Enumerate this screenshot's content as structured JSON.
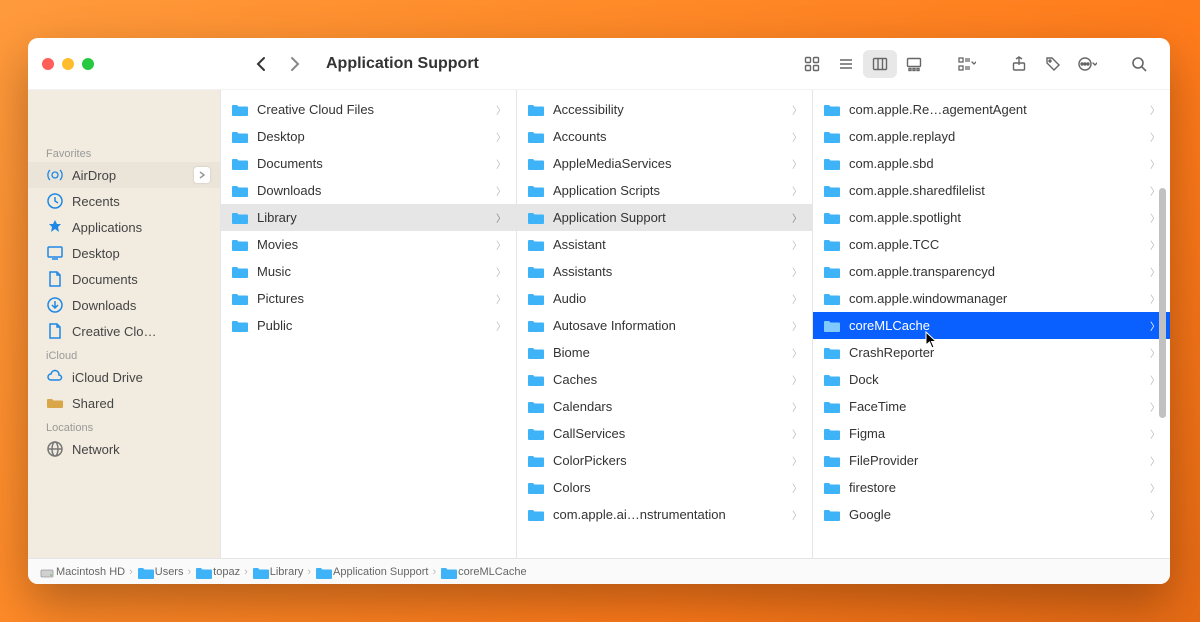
{
  "window": {
    "title": "Application Support"
  },
  "traffic": {
    "close": "close",
    "min": "minimize",
    "max": "maximize"
  },
  "sidebar": {
    "sections": [
      {
        "label": "Favorites",
        "items": [
          {
            "icon": "airdrop",
            "label": "AirDrop",
            "showChevron": true
          },
          {
            "icon": "clock",
            "label": "Recents"
          },
          {
            "icon": "app",
            "label": "Applications"
          },
          {
            "icon": "desktop",
            "label": "Desktop"
          },
          {
            "icon": "doc",
            "label": "Documents"
          },
          {
            "icon": "download",
            "label": "Downloads"
          },
          {
            "icon": "doc",
            "label": "Creative Clo…"
          }
        ]
      },
      {
        "label": "iCloud",
        "items": [
          {
            "icon": "cloud",
            "label": "iCloud Drive"
          },
          {
            "icon": "shared",
            "label": "Shared"
          }
        ]
      },
      {
        "label": "Locations",
        "items": [
          {
            "icon": "network",
            "label": "Network"
          }
        ]
      }
    ]
  },
  "column1": {
    "items": [
      {
        "label": "Creative Cloud Files"
      },
      {
        "label": "Desktop"
      },
      {
        "label": "Documents"
      },
      {
        "label": "Downloads"
      },
      {
        "label": "Library",
        "path": true
      },
      {
        "label": "Movies"
      },
      {
        "label": "Music"
      },
      {
        "label": "Pictures"
      },
      {
        "label": "Public"
      }
    ]
  },
  "column2": {
    "items": [
      {
        "label": "Accessibility"
      },
      {
        "label": "Accounts"
      },
      {
        "label": "AppleMediaServices"
      },
      {
        "label": "Application Scripts"
      },
      {
        "label": "Application Support",
        "path": true
      },
      {
        "label": "Assistant"
      },
      {
        "label": "Assistants"
      },
      {
        "label": "Audio"
      },
      {
        "label": "Autosave Information"
      },
      {
        "label": "Biome"
      },
      {
        "label": "Caches"
      },
      {
        "label": "Calendars"
      },
      {
        "label": "CallServices"
      },
      {
        "label": "ColorPickers"
      },
      {
        "label": "Colors"
      },
      {
        "label": "com.apple.ai…nstrumentation"
      }
    ]
  },
  "column3": {
    "items": [
      {
        "label": "com.apple.Re…agementAgent"
      },
      {
        "label": "com.apple.replayd"
      },
      {
        "label": "com.apple.sbd"
      },
      {
        "label": "com.apple.sharedfilelist"
      },
      {
        "label": "com.apple.spotlight"
      },
      {
        "label": "com.apple.TCC"
      },
      {
        "label": "com.apple.transparencyd"
      },
      {
        "label": "com.apple.windowmanager"
      },
      {
        "label": "coreMLCache",
        "selected": true
      },
      {
        "label": "CrashReporter"
      },
      {
        "label": "Dock"
      },
      {
        "label": "FaceTime"
      },
      {
        "label": "Figma"
      },
      {
        "label": "FileProvider"
      },
      {
        "label": "firestore"
      },
      {
        "label": "Google"
      }
    ]
  },
  "breadcrumb": [
    {
      "icon": "drive",
      "label": "Macintosh HD"
    },
    {
      "icon": "folder",
      "label": "Users"
    },
    {
      "icon": "folder",
      "label": "topaz"
    },
    {
      "icon": "folder",
      "label": "Library"
    },
    {
      "icon": "folder",
      "label": "Application Support"
    },
    {
      "icon": "folder",
      "label": "coreMLCache"
    }
  ],
  "colors": {
    "accent": "#0a5fff",
    "folder": "#3fb3f7",
    "sidebarBg": "#f2ece0"
  }
}
